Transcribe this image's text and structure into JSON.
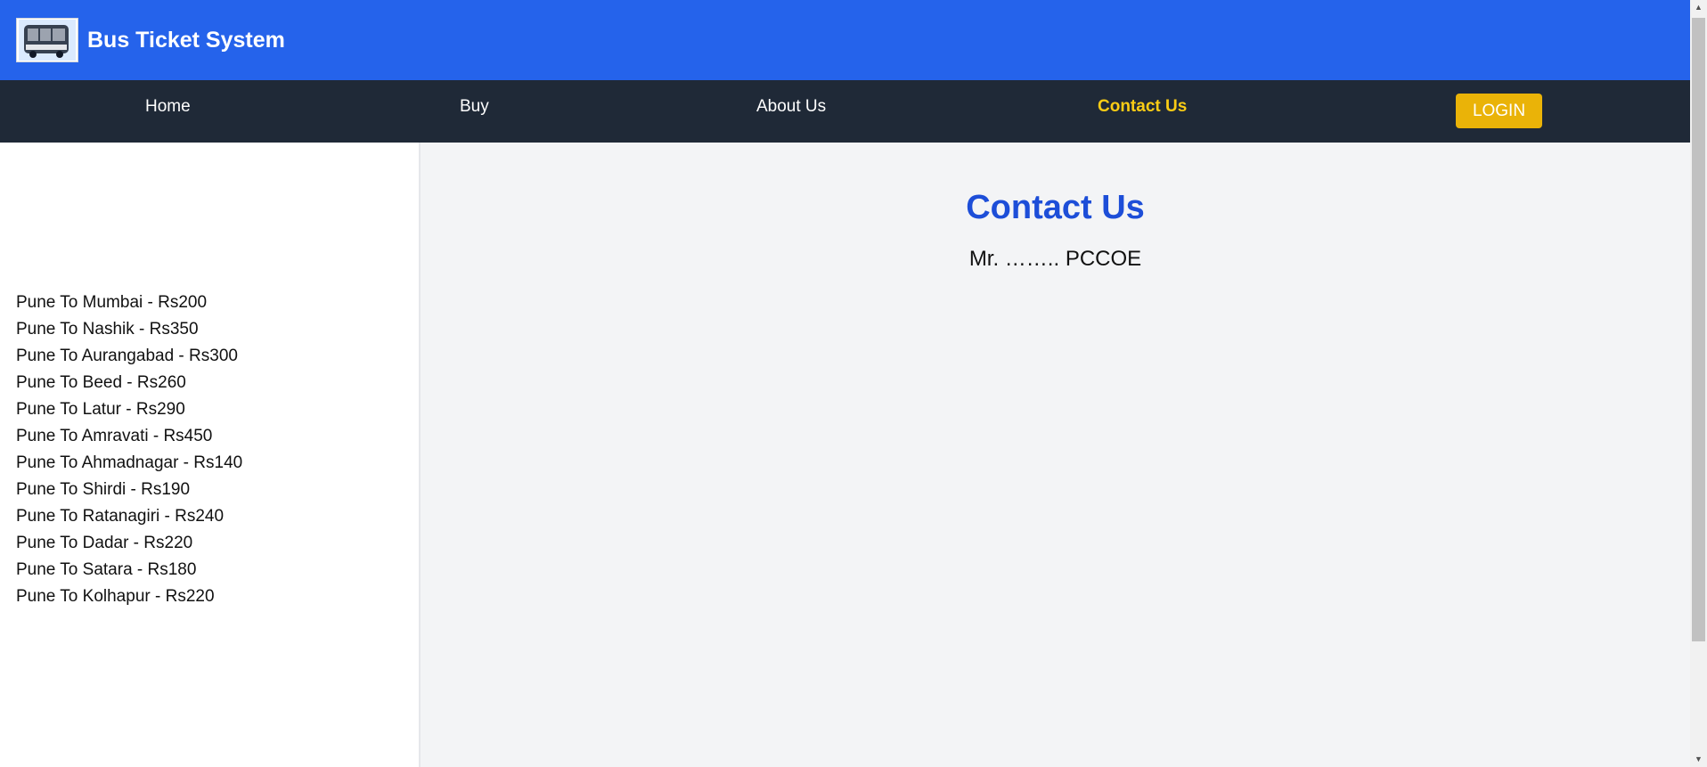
{
  "header": {
    "title": "Bus Ticket System",
    "logo_icon": "bus-icon"
  },
  "nav": {
    "items": [
      {
        "label": "Home"
      },
      {
        "label": "Buy"
      },
      {
        "label": "About Us"
      },
      {
        "label": "Contact Us",
        "active": true
      }
    ],
    "login_label": "LOGIN"
  },
  "sidebar": {
    "routes": [
      "Pune To Mumbai - Rs200",
      "Pune To Nashik - Rs350",
      "Pune To Aurangabad - Rs300",
      "Pune To Beed - Rs260",
      "Pune To Latur - Rs290",
      "Pune To Amravati - Rs450",
      "Pune To Ahmadnagar - Rs140",
      "Pune To Shirdi - Rs190",
      "Pune To Ratanagiri - Rs240",
      "Pune To Dadar - Rs220",
      "Pune To Satara - Rs180",
      "Pune To Kolhapur - Rs220"
    ]
  },
  "main": {
    "title": "Contact Us",
    "text": "Mr. …….. PCCOE"
  },
  "colors": {
    "header_bg": "#2563eb",
    "nav_bg": "#1f2937",
    "active_nav": "#facc15",
    "login_bg": "#eab308",
    "title_color": "#1d4ed8"
  }
}
